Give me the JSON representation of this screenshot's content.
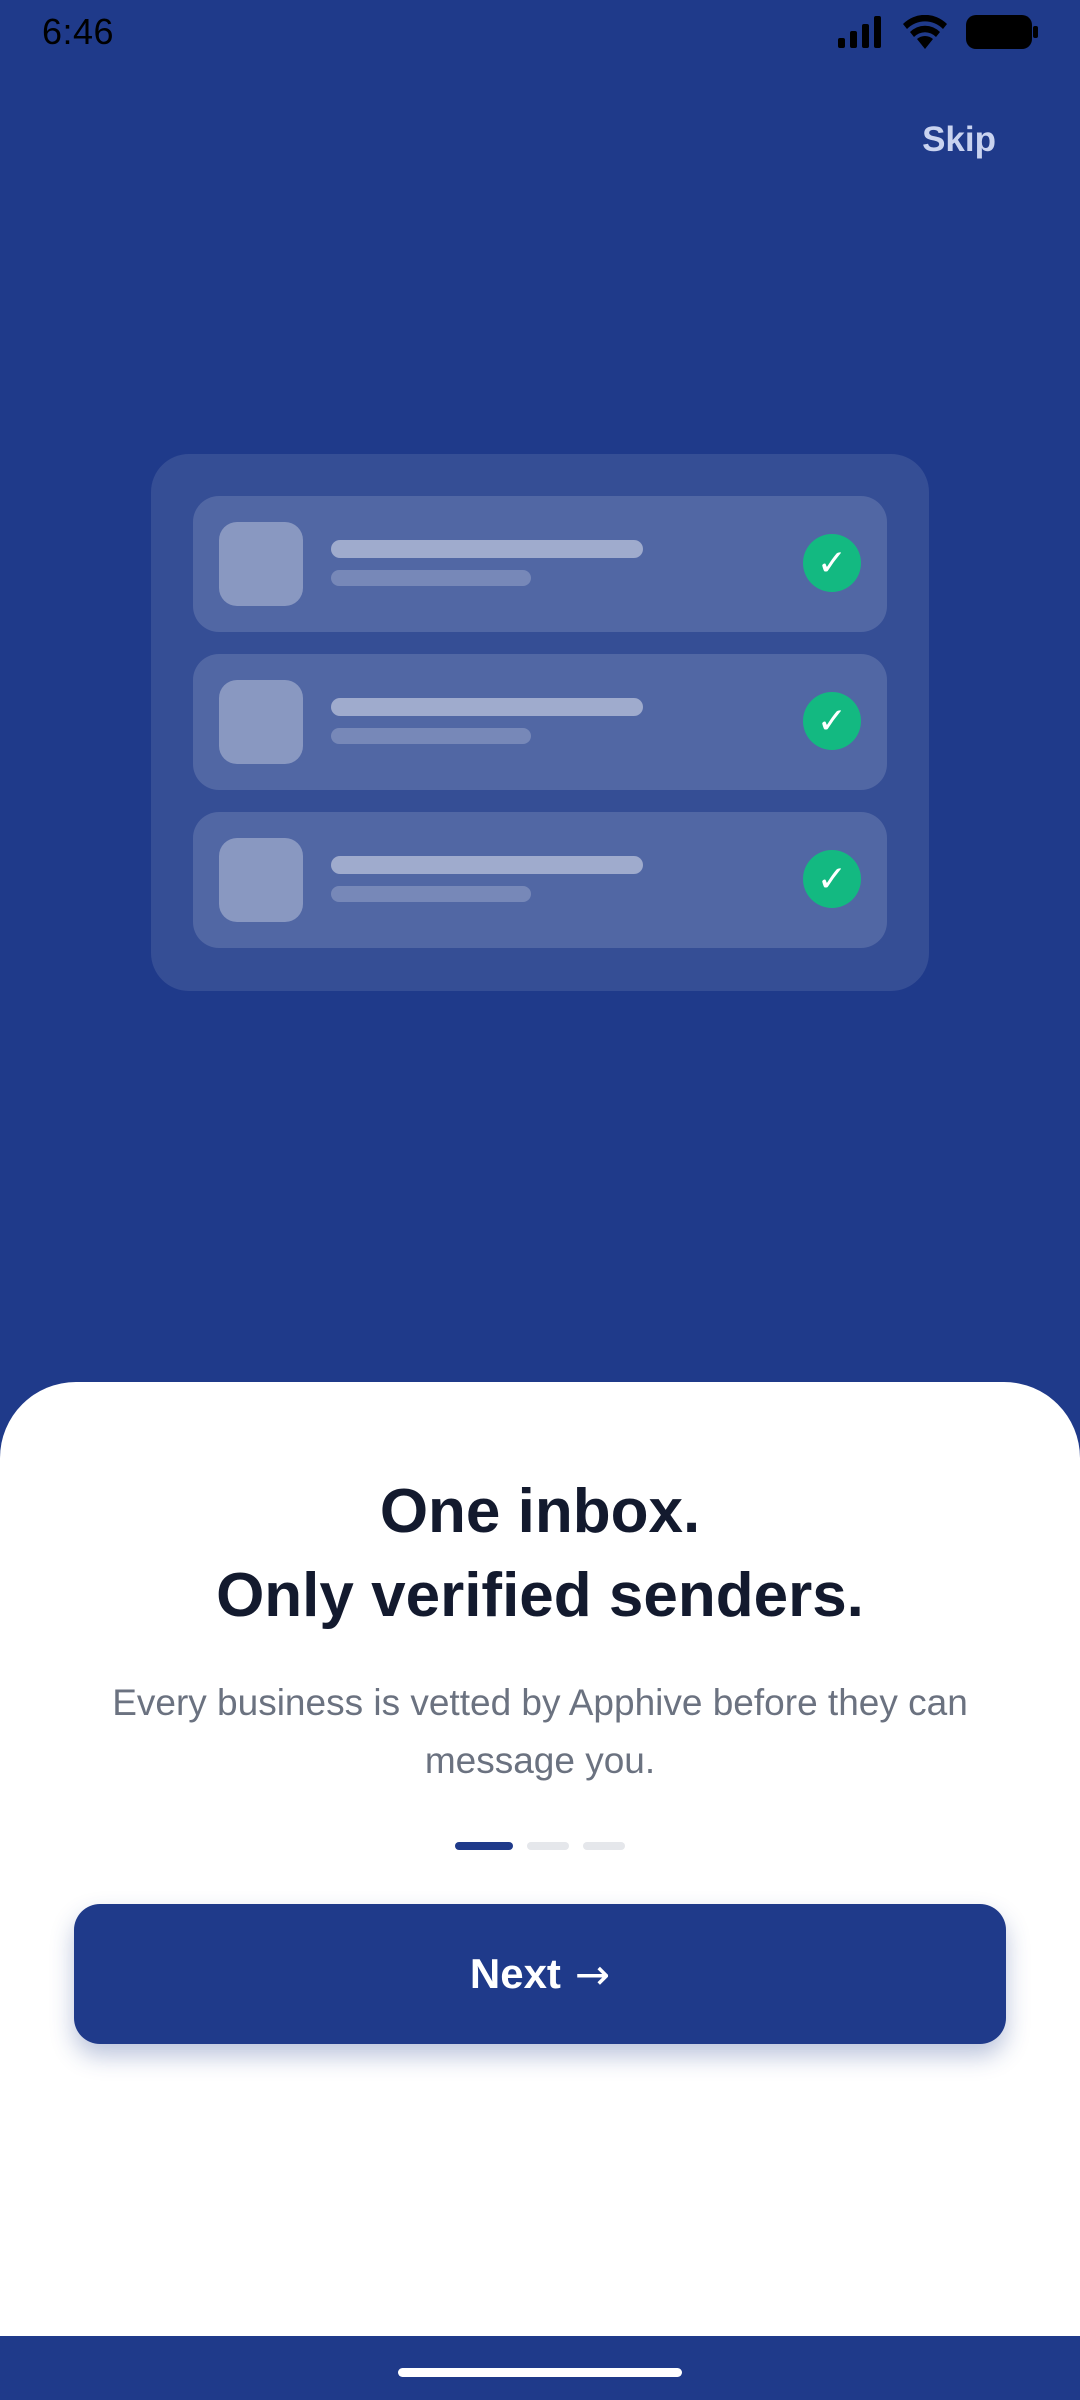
{
  "status_bar": {
    "time": "6:46",
    "icons": [
      "signal-icon",
      "wifi-icon",
      "battery-icon"
    ]
  },
  "skip_label": "Skip",
  "illustration": {
    "rows": [
      {
        "check_glyph": "✓"
      },
      {
        "check_glyph": "✓"
      },
      {
        "check_glyph": "✓"
      }
    ]
  },
  "onboarding": {
    "title_line1": "One inbox.",
    "title_line2": "Only verified senders.",
    "subtitle": "Every business is vetted by Apphive before they can message you.",
    "page_indicator": {
      "current": 1,
      "total": 3
    },
    "next_label": "Next",
    "next_arrow": "→"
  },
  "colors": {
    "primary": "#1f3a8a",
    "check": "#13b981",
    "title": "#131a2e",
    "subtitle": "#6b7280"
  }
}
